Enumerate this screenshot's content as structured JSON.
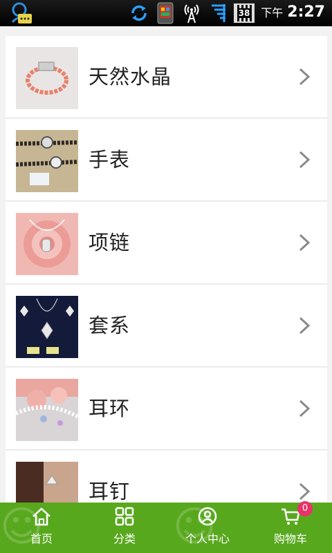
{
  "status_bar": {
    "ampm": "下午",
    "time": "2:27",
    "battery": "38"
  },
  "categories": [
    {
      "label": "天然水晶",
      "thumb": "bracelet"
    },
    {
      "label": "手表",
      "thumb": "watch"
    },
    {
      "label": "项链",
      "thumb": "necklace-rose"
    },
    {
      "label": "套系",
      "thumb": "jewelry-set"
    },
    {
      "label": "耳环",
      "thumb": "earrings-lace"
    },
    {
      "label": "耳钉",
      "thumb": "ear-studs"
    }
  ],
  "tabbar": {
    "tabs": [
      {
        "label": "首页",
        "icon": "home-icon"
      },
      {
        "label": "分类",
        "icon": "grid-icon"
      },
      {
        "label": "个人中心",
        "icon": "user-icon"
      },
      {
        "label": "购物车",
        "icon": "cart-icon"
      }
    ],
    "cart_count": "0"
  },
  "colors": {
    "tabbar": "#58a81e",
    "badge": "#e8336a"
  }
}
